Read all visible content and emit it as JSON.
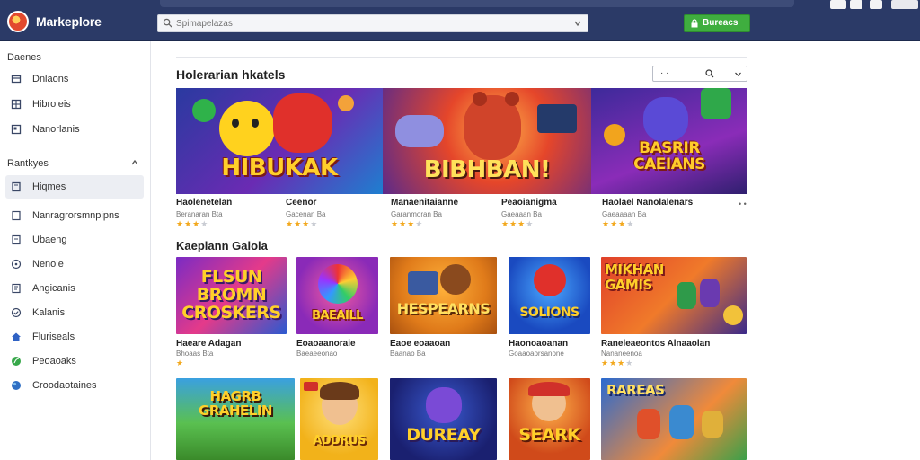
{
  "app": {
    "name": "Markeplore"
  },
  "search": {
    "placeholder": "Spimapelazas"
  },
  "header": {
    "action_label": "Bureacs"
  },
  "sidebar": {
    "section1_title": "Daenes",
    "section1_items": [
      {
        "label": "Dnlaons",
        "icon": "cart-icon"
      },
      {
        "label": "Hibroleis",
        "icon": "grid-icon"
      },
      {
        "label": "Nanorlanis",
        "icon": "list-icon"
      }
    ],
    "section2_title": "Rantkyes",
    "section2_items": [
      {
        "label": "Hiqmes",
        "icon": "bookmark-icon",
        "active": true
      },
      {
        "label": "Nanragrorsmnpipns",
        "icon": "document-icon"
      },
      {
        "label": "Ubaeng",
        "icon": "tag-icon"
      },
      {
        "label": "Nenoie",
        "icon": "compass-icon"
      },
      {
        "label": "Angicanis",
        "icon": "note-icon"
      },
      {
        "label": "Kalanis",
        "icon": "check-circle-icon"
      },
      {
        "label": "Fluriseals",
        "icon": "home-icon"
      },
      {
        "label": "Peoaoaks",
        "icon": "leaf-icon"
      },
      {
        "label": "Croodaotaines",
        "icon": "globe-icon"
      }
    ]
  },
  "featured": {
    "heading": "Holerarian hkatels",
    "sort_value": "· ·",
    "banners": [
      {
        "art_text": "HIBUKAK"
      },
      {
        "art_text": "BIBHBAN!"
      },
      {
        "art_text": "BASRIR CAEIANS"
      }
    ],
    "cards": [
      {
        "title": "Haolenetelan",
        "meta": "Beranaran Bta",
        "rating": 3
      },
      {
        "title": "Ceenor",
        "meta": "Gacenan Ba",
        "rating": 3
      },
      {
        "title": "Manaenitaianne",
        "meta": "Garanmoran Ba",
        "rating": 3
      },
      {
        "title": "Peaoianigma",
        "meta": "Gaeaaan Ba",
        "rating": 3
      },
      {
        "title": "Haolael Nanolalenars",
        "meta": "Gaeaaaan Ba",
        "rating": 3
      }
    ],
    "more": "• •"
  },
  "section2": {
    "heading": "Kaeplann Galola",
    "row1": [
      {
        "art_text": "FLSUN BROMN CROSKERS",
        "title": "Haeare Adagan",
        "meta": "Bhoaas Bta",
        "rating": 1
      },
      {
        "art_text": "BAEAILL",
        "title": "Eoaoaanoraie",
        "meta": "Baeaeeonao",
        "rating": 0
      },
      {
        "art_text": "HESPEARNS",
        "title": "Eaoe eoaaoan",
        "meta": "Baanao Ba",
        "rating": 0
      },
      {
        "art_text": "SOLIONS",
        "title": "Haonoaoanan",
        "meta": "Goaaoaorsanone",
        "rating": 0
      },
      {
        "art_text": "MIKHAN GAMIS",
        "title": "Raneleaeontos Alnaaolan",
        "meta": "Nananeenoa",
        "rating": 3
      }
    ],
    "row2": [
      {
        "art_text": "HAGRB GRAHELIN"
      },
      {
        "art_text": "ADDRUS"
      },
      {
        "art_text": "DUREAY"
      },
      {
        "art_text": "SEARK"
      },
      {
        "art_text": "RAREAS"
      }
    ]
  },
  "colors": {
    "topbar": "#2b3a67",
    "action_green": "#3fae3f",
    "star": "#f2a81d"
  }
}
